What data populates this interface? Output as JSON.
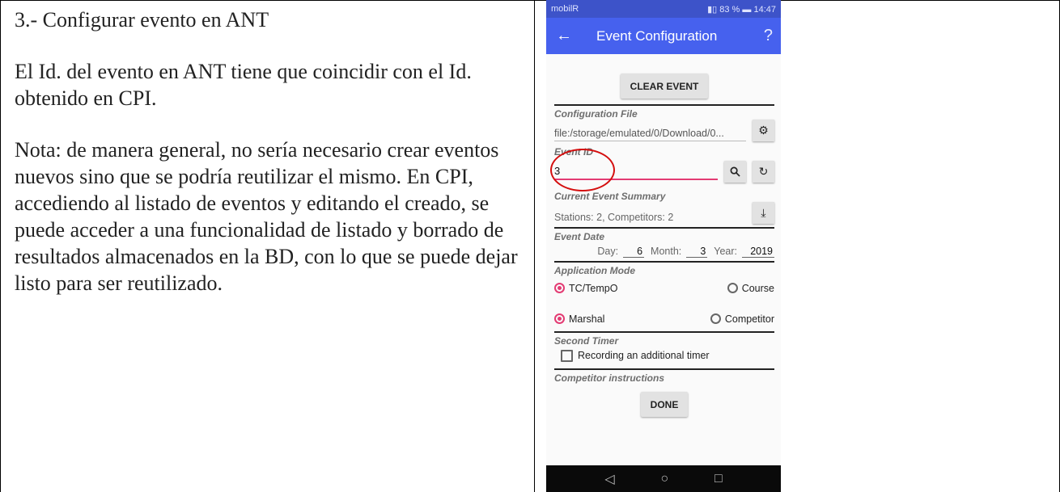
{
  "doc": {
    "heading": "3.- Configurar evento en ANT",
    "para1": "El Id. del evento en ANT tiene que coincidir con el Id. obtenido en CPI.",
    "para2": "Nota: de manera general, no sería necesario crear eventos nuevos sino que se podría reutilizar el mismo. En CPI, accediendo al listado de eventos y editando el creado, se puede acceder a una funcionalidad de listado y borrado de resultados almacenados en la BD, con lo que se puede dejar listo para ser reutilizado."
  },
  "phone": {
    "status": {
      "carrier": "mobilR",
      "indicators": "83 %",
      "time": "14:47"
    },
    "appbar": {
      "back_icon": "arrow-left-icon",
      "title": "Event Configuration",
      "help_icon": "?"
    },
    "clear_button": "CLEAR EVENT",
    "config_file": {
      "label": "Configuration File",
      "value": "file:/storage/emulated/0/Download/0...",
      "icon": "gear-icon"
    },
    "event_id": {
      "label": "Event ID",
      "value": "3",
      "search_icon": "search-icon",
      "refresh_icon": "refresh-icon"
    },
    "summary": {
      "label": "Current Event Summary",
      "value": "Stations: 2, Competitors: 2",
      "icon": "download-icon"
    },
    "event_date": {
      "label": "Event Date",
      "day_label": "Day:",
      "day": "6",
      "month_label": "Month:",
      "month": "3",
      "year_label": "Year:",
      "year": "2019"
    },
    "app_mode": {
      "label": "Application Mode",
      "opt1": "TC/TempO",
      "opt2": "Course",
      "opt3": "Marshal",
      "opt4": "Competitor",
      "selected": [
        "TC/TempO",
        "Marshal"
      ]
    },
    "second_timer": {
      "label": "Second Timer",
      "checkbox": "Recording an additional timer",
      "checked": false
    },
    "competitor_instructions": {
      "label": "Competitor instructions"
    },
    "done_button": "DONE",
    "nav": {
      "back": "◁",
      "home": "○",
      "recent": "□"
    },
    "accent": "#e33b73",
    "annotation_color": "#d40e0e"
  }
}
